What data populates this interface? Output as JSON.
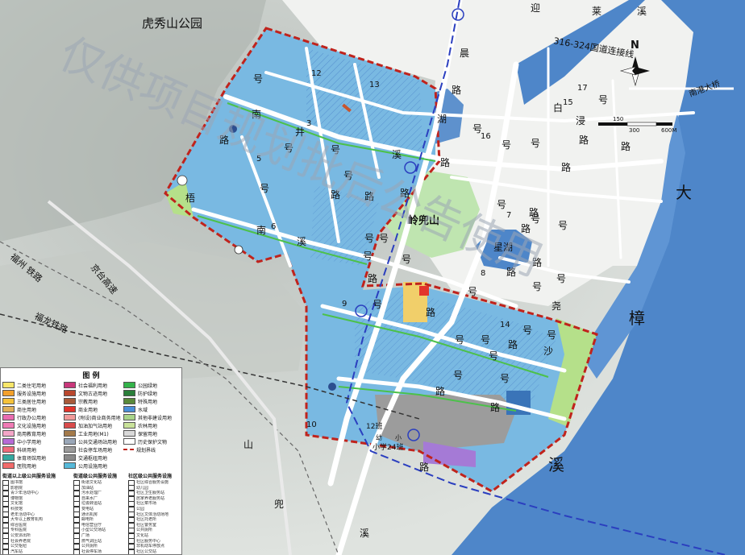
{
  "map_labels": {
    "park": "虎秀山公园",
    "mountain": "岭兜山",
    "lake": "星湖",
    "river_big_1": "大",
    "river_big_2": "樟",
    "river_xi": "溪",
    "bridge": "南港大桥",
    "highway": "316-324国道连接线",
    "north": "N",
    "scale_150": "150",
    "scale_300": "300",
    "scale_600": "600M",
    "rail_1": "福州 铁路",
    "rail_2": "福龙铁路",
    "expressway": "京台高速",
    "blue_line": "规划界",
    "school_1": "12班",
    "school_2": "幼",
    "school_3": "小",
    "school_4": "小学24班",
    "road_chars": [
      "南",
      "井",
      "号",
      "溪",
      "路",
      "号",
      "号",
      "路",
      "梧",
      "南",
      "溪",
      "号",
      "号",
      "路",
      "路",
      "号",
      "号",
      "号",
      "路",
      "号",
      "号",
      "路",
      "路",
      "号",
      "路",
      "号",
      "号",
      "号",
      "路",
      "号",
      "湖",
      "路",
      "晨",
      "迎",
      "莱",
      "溪",
      "白",
      "浸",
      "号",
      "路",
      "路",
      "号",
      "路",
      "路",
      "号",
      "号",
      "路",
      "号",
      "路",
      "号",
      "号",
      "路",
      "号",
      "尧",
      "号",
      "沙",
      "号",
      "号",
      "路",
      "山",
      "兜",
      "溪",
      "路",
      "号"
    ],
    "road_numbers": [
      "12",
      "13",
      "17",
      "15",
      "3",
      "16",
      "5",
      "7",
      "6",
      "8",
      "9",
      "14",
      "10"
    ]
  },
  "watermark": "仅供项目规划批后公告使用",
  "legend": {
    "title": "图 例",
    "land_use": [
      {
        "label": "二类住宅用地",
        "color": "#f8e66a"
      },
      {
        "label": "社会福利用地",
        "color": "#c8377a"
      },
      {
        "label": "公园绿地",
        "color": "#33b34a"
      },
      {
        "label": "服务设施用地",
        "color": "#f3a02a"
      },
      {
        "label": "文物古迹用地",
        "color": "#b9472d"
      },
      {
        "label": "防护绿地",
        "color": "#2a7f3a"
      },
      {
        "label": "三类居住用地",
        "color": "#f5c23a"
      },
      {
        "label": "宗教用地",
        "color": "#a85a3a"
      },
      {
        "label": "特殊用地",
        "color": "#5a8a3a"
      },
      {
        "label": "商住用地",
        "color": "#e0b05a"
      },
      {
        "label": "商业用地",
        "color": "#e2342b"
      },
      {
        "label": "水域",
        "color": "#4a8fd8"
      },
      {
        "label": "行政办公用地",
        "color": "#e96bb0"
      },
      {
        "label": "(附设)商业商务用地",
        "color": "#f09a9a"
      },
      {
        "label": "其他非建设用地",
        "color": "#a8d48a"
      },
      {
        "label": "文化设施用地",
        "color": "#f07bb5"
      },
      {
        "label": "加油加气站用地",
        "color": "#d94b4b"
      },
      {
        "label": "农林用地",
        "color": "#c9e29a"
      },
      {
        "label": "商用教育用地",
        "color": "#f4a6c8"
      },
      {
        "label": "工业用地(M1)",
        "color": "#a47a4a"
      },
      {
        "label": "保留用地",
        "color": "#d9d9d9"
      },
      {
        "label": "中小学用地",
        "color": "#b66ad6"
      },
      {
        "label": "公共交通场站用地",
        "color": "#9aa7b8"
      },
      {
        "label": "历史保护文物",
        "color": "#ffffff"
      },
      {
        "label": "科研用地",
        "color": "#f06a7a"
      },
      {
        "label": "社会停车场用地",
        "color": "#9b9b9b"
      },
      {
        "label": "规划界线",
        "color": "#ffffff"
      },
      {
        "label": "体育场馆用地",
        "color": "#33a9a0"
      },
      {
        "label": "交通枢纽用地",
        "color": "#8a8a8a"
      },
      {
        "label": "",
        "color": ""
      },
      {
        "label": "医院用地",
        "color": "#f26b6b"
      },
      {
        "label": "公用设施用地",
        "color": "#56b9d9"
      },
      {
        "label": "",
        "color": ""
      }
    ],
    "sections": [
      "街道以上级公共服务设施",
      "街道级公共服务设施",
      "社区级公共服务设施"
    ],
    "facilities_1": [
      "图书馆",
      "影剧院",
      "青少年活动中心",
      "博物馆",
      "文化馆",
      "科技馆",
      "老年活动中心",
      "大专以上教育机构",
      "综合医院",
      "专科医院",
      "公安派出所",
      "社会养老院",
      "公交枢纽",
      "汽车站",
      "消防站",
      "社区服务中心",
      "街道办事处"
    ],
    "facilities_2": [
      "街道文化站",
      "加油站",
      "污水处理厂",
      "自来水厂",
      "垃圾转运站",
      "变电站",
      "通讯机房",
      "邮电所",
      "电信营业厅",
      "小型公交场站",
      "广场",
      "燃气调压站",
      "公共厕所",
      "社会停车场",
      "公交首末站",
      "中学",
      "街道综合服务站"
    ],
    "facilities_3": [
      "社区综合服务设施",
      "幼儿园",
      "社区卫生服务站",
      "居家养老服务站",
      "社区菜市场",
      "公园",
      "社区文体活动场地",
      "社区托老所",
      "社区警务室",
      "公共厕所",
      "文化站",
      "社区服务中心",
      "非机动车停放点",
      "社区公交站",
      "小学"
    ]
  }
}
